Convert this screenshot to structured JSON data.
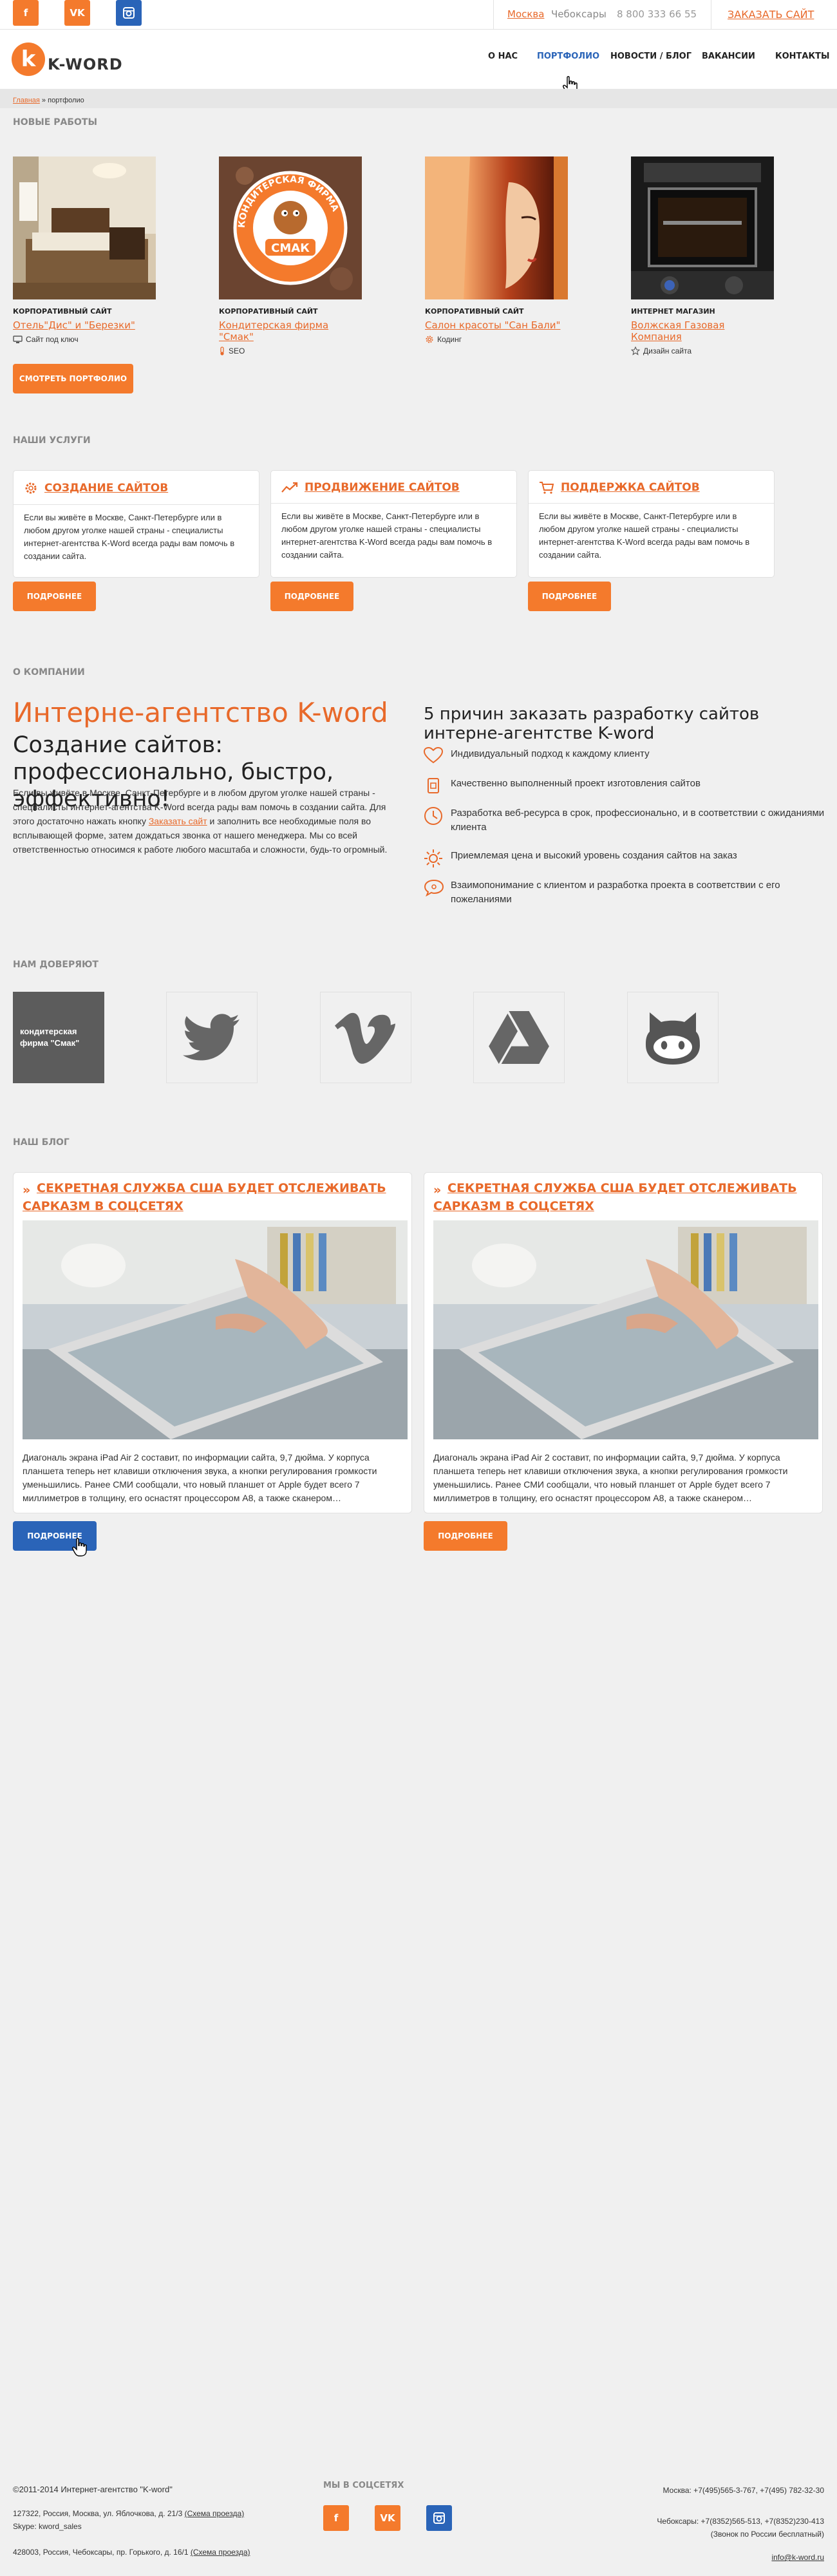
{
  "topbar": {
    "social": [
      {
        "label": "f",
        "color": "#f47a2c",
        "icon": "facebook-icon"
      },
      {
        "label": "VK",
        "color": "#f47a2c",
        "icon": "vk-icon"
      },
      {
        "label": "▣",
        "color": "#2a64b8",
        "icon": "instagram-icon"
      }
    ],
    "city_active": "Москва",
    "city_other": "Чебоксары",
    "phone": "8 800 333 66 55",
    "order_link": "ЗАКАЗАТЬ САЙТ"
  },
  "header": {
    "logo_letter": "k",
    "logo_word": "K-WORD",
    "nav": [
      "О НАС",
      "ПОРТФОЛИО",
      "НОВОСТИ / БЛОГ",
      "ВАКАНСИИ",
      "КОНТАКТЫ"
    ],
    "active_nav": "ПОРТФОЛИО",
    "accent_color": "#f47a2c",
    "active_color": "#2a64b8"
  },
  "breadcrumbs": {
    "home": "Главная",
    "separator": " » ",
    "current": "портфолио"
  },
  "new_works": {
    "title": "НОВЫЕ РАБОТЫ",
    "items": [
      {
        "type": "КОРПОРАТИВНЫЙ САЙТ",
        "title": "Отель\"Дис\" и \"Березки\"",
        "tag": "Сайт под ключ",
        "tag_icon": "monitor-icon"
      },
      {
        "type": "КОРПОРАТИВНЫЙ САЙТ",
        "title": "Кондитерская фирма \"Смак\"",
        "tag": "SEO",
        "tag_icon": "thermometer-icon",
        "logo_text": "СМАК",
        "logo_arc": "КОНДИТЕРСКАЯ ФИРМА"
      },
      {
        "type": "КОРПОРАТИВНЫЙ САЙТ",
        "title": "Салон красоты \"Сан Бали\"",
        "tag": "Кодинг",
        "tag_icon": "gear-icon"
      },
      {
        "type": "ИНТЕРНЕТ МАГАЗИН",
        "title": "Волжская Газовая Компания",
        "tag": "Дизайн сайта",
        "tag_icon": "star-icon"
      }
    ],
    "button": "СМОТРЕТЬ ПОРТФОЛИО"
  },
  "services": {
    "title": "НАШИ УСЛУГИ",
    "items": [
      {
        "title": "СОЗДАНИЕ САЙТОВ",
        "icon": "gear-icon",
        "text": "Если вы живёте в Москве, Санкт-Петербурге или в любом другом уголке нашей страны - специалисты интернет-агентства K-Word всегда рады вам помочь в создании сайта.",
        "button": "ПОДРОБНЕЕ"
      },
      {
        "title": "ПРОДВИЖЕНИЕ САЙТОВ",
        "icon": "trend-icon",
        "text": "Если вы живёте в Москве, Санкт-Петербурге или в любом другом уголке нашей страны - специалисты интернет-агентства K-Word всегда рады вам помочь в создании сайта.",
        "button": "ПОДРОБНЕЕ"
      },
      {
        "title": "ПОДДЕРЖКА САЙТОВ",
        "icon": "cart-icon",
        "text": "Если вы живёте в Москве, Санкт-Петербурге или в любом другом уголке нашей страны - специалисты интернет-агентства K-Word всегда рады вам помочь в создании сайта.",
        "button": "ПОДРОБНЕЕ"
      }
    ]
  },
  "about": {
    "title": "О КОМПАНИИ",
    "heading": "Интерне-агентство K-word",
    "subheading": "Создание сайтов: профессионально, быстро, эффективно!",
    "text_before_link": "Если вы живёте в Москве, Санкт-Петербурге и в любом другом уголке нашей страны - специалисты интернет-агентства K-Word всегда рады вам помочь в создании сайта. Для этого достаточно нажать кнопку ",
    "link": "Заказать сайт",
    "text_after_link": " и заполнить все необходимые поля во всплывающей форме, затем дождаться звонка от нашего менеджера. Мы со всей ответственностью относимся к работе любого масштаба и сложности, будь-то огромный.",
    "reasons_heading": "5 причин заказать разработку сайтов интерне-агентстве K-word",
    "reasons": [
      {
        "text": "Индивидуальный подход к каждому клиенту",
        "icon": "heart-icon"
      },
      {
        "text": "Качественно выполненный проект изготовления сайтов",
        "icon": "doc-icon"
      },
      {
        "text": "Разработка веб-ресурса в срок, профессионально, и в соответствии с ожиданиями клиента",
        "icon": "clock-icon"
      },
      {
        "text": "Приемлемая цена и высокий уровень создания сайтов на заказ",
        "icon": "sun-icon"
      },
      {
        "text": "Взаимопонимание с клиентом и разработка проекта в соответствии с его пожеланиями",
        "icon": "chat-icon"
      }
    ]
  },
  "partners": {
    "title": "НАМ ДОВЕРЯЮТ",
    "first_label": "кондитерская фирма \"Смак\"",
    "items": [
      "smak-logo",
      "twitter-icon",
      "vimeo-icon",
      "google-drive-icon",
      "github-icon"
    ]
  },
  "blog": {
    "title": "НАШ БЛОГ",
    "posts": [
      {
        "title": "СЕКРЕТНАЯ СЛУЖБА США БУДЕТ  ОТСЛЕЖИВАТЬ САРКАЗМ В СОЦСЕТЯХ",
        "text": "Диагональ экрана iPad Air 2 составит, по информации сайта, 9,7 дюйма. У корпуса планшета теперь нет клавиши отключения звука, а кнопки регулирования громкости уменьшились. Ранее СМИ сообщали, что новый планшет от Apple будет всего 7 миллиметров в толщину, его оснастят процессором A8, а также сканером…",
        "button": "ПОДРОБНЕЕ",
        "button_color": "#2a64b8"
      },
      {
        "title": "СЕКРЕТНАЯ СЛУЖБА США БУДЕТ  ОТСЛЕЖИВАТЬ САРКАЗМ В СОЦСЕТЯХ",
        "text": "Диагональ экрана iPad Air 2 составит, по информации сайта, 9,7 дюйма. У корпуса планшета теперь нет клавиши отключения звука, а кнопки регулирования громкости уменьшились. Ранее СМИ сообщали, что новый планшет от Apple будет всего 7 миллиметров в толщину, его оснастят процессором A8, а также сканером…",
        "button": "ПОДРОБНЕЕ",
        "button_color": "#f47a2c"
      }
    ]
  },
  "footer": {
    "copyright": "©2011-2014 Интернет-агентство \"K-word\"",
    "address1": "127322, Россия, Москва, ул. Яблочкова, д. 21/3 ",
    "map_link": "(Схема проезда)",
    "skype": "Skype: kword_sales",
    "address2": "428003, Россия, Чебоксары, пр. Горького, д. 16/1 ",
    "social_title": "МЫ В СОЦСЕТЯХ",
    "moscow_phones": "Москва: +7(495)565-3-767, +7(495) 782-32-30",
    "cheb_phones": "Чебоксары: +7(8352)565-513, +7(8352)230-413",
    "free_call": "(Звонок по России бесплатный)",
    "email": "info@k-word.ru"
  }
}
